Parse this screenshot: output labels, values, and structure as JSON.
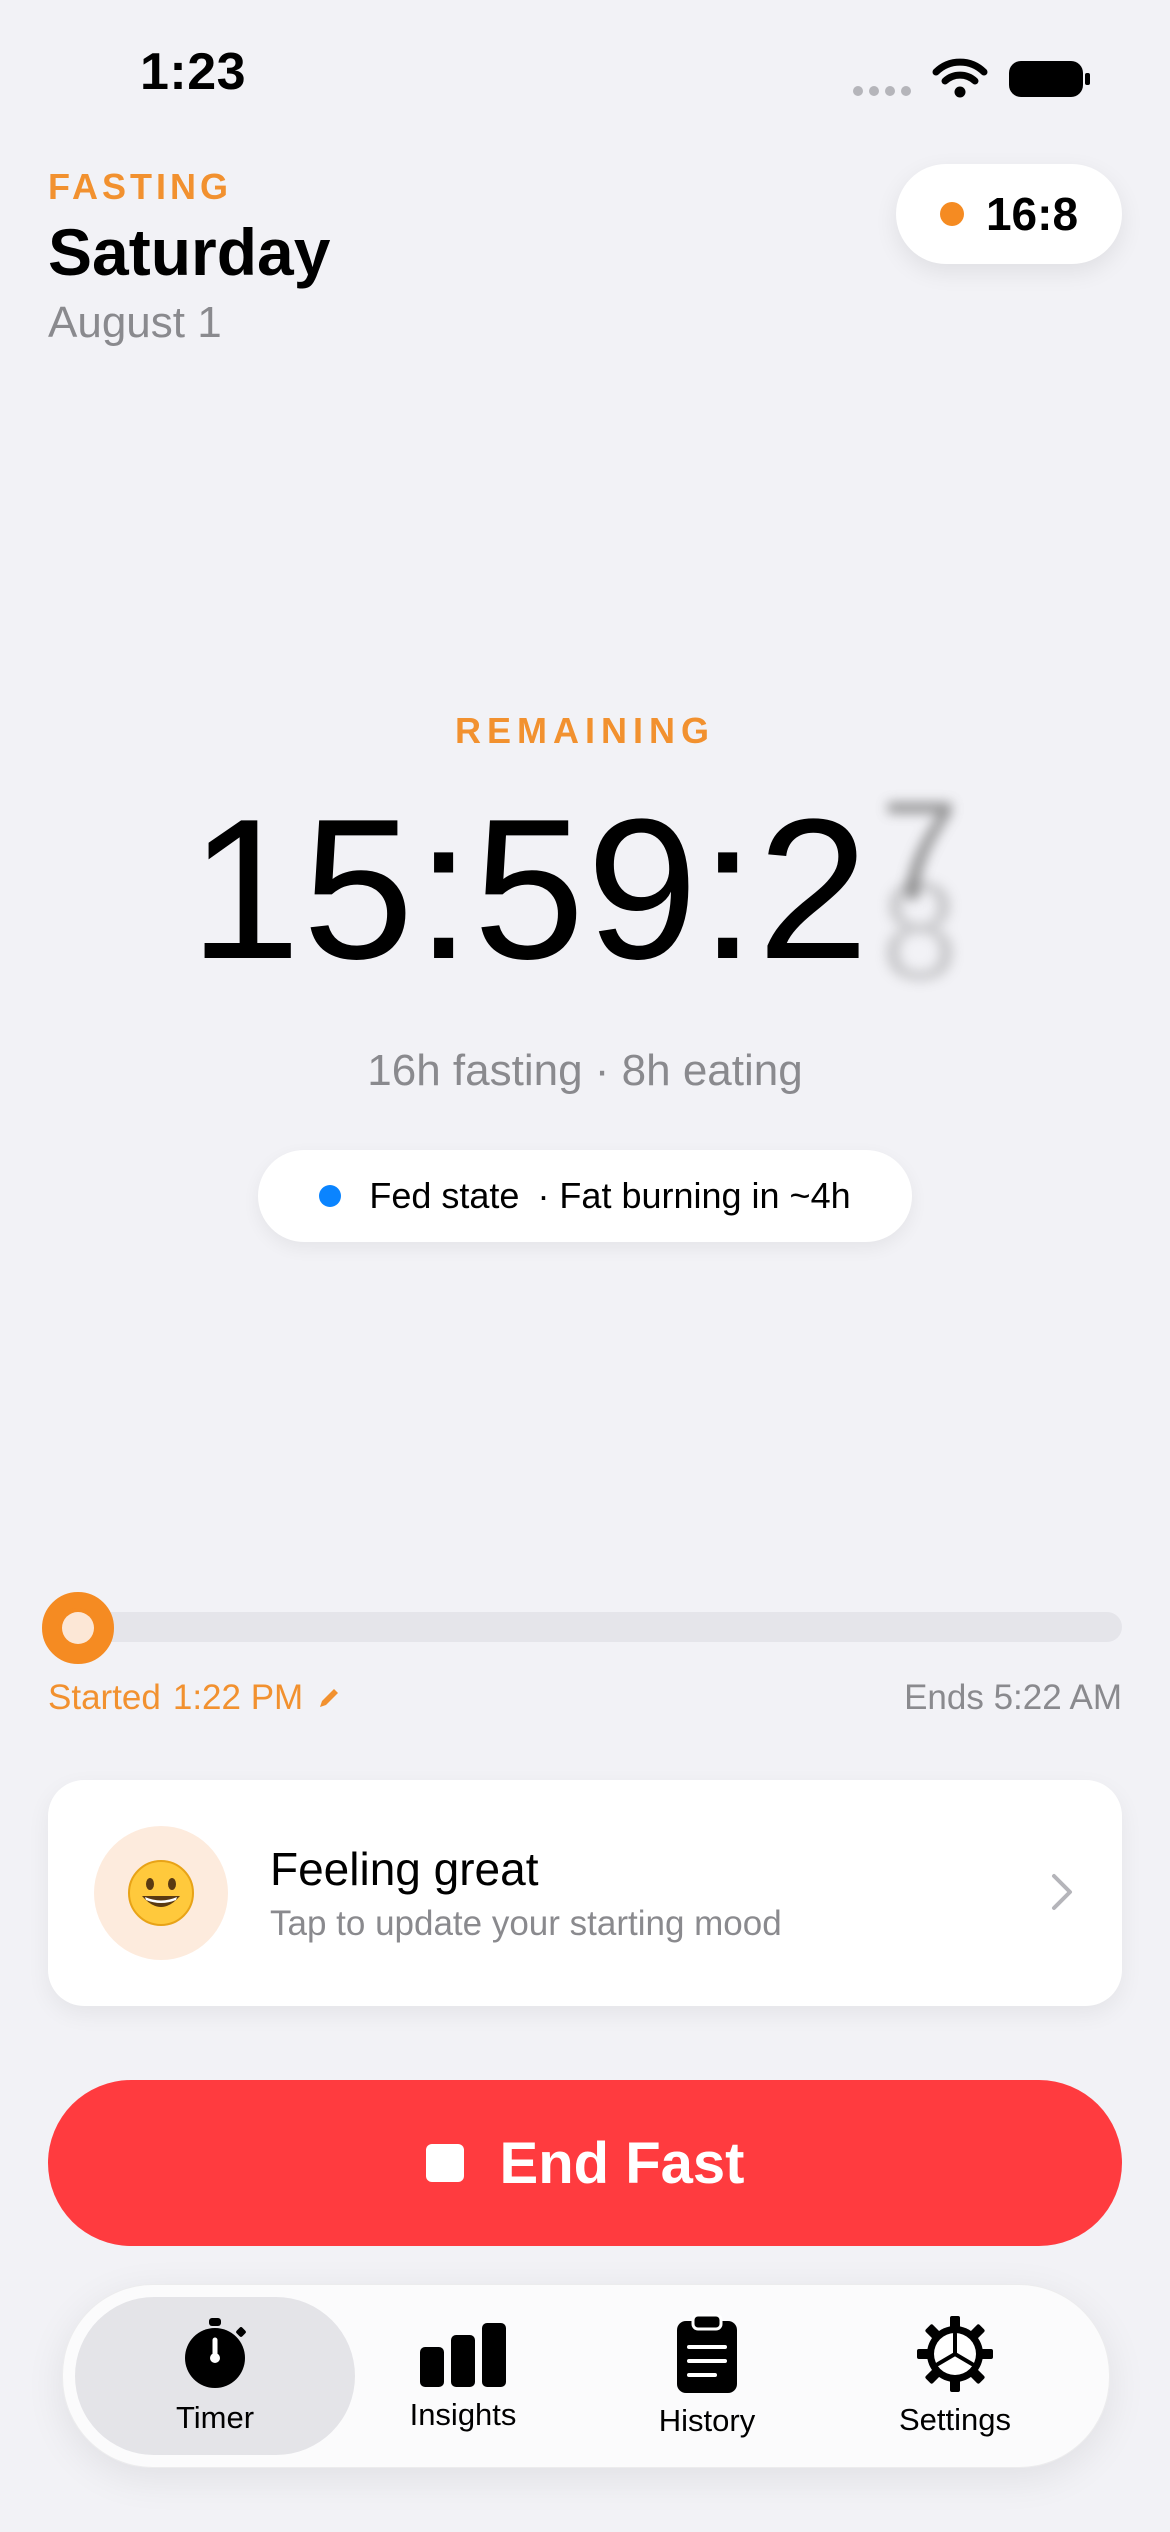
{
  "status_bar": {
    "time": "1:23"
  },
  "header": {
    "eyebrow": "FASTING",
    "day": "Saturday",
    "date": "August 1",
    "plan_label": "16:8"
  },
  "timer": {
    "heading": "REMAINING",
    "value": "15:59:2",
    "rolling_digit_top": "7",
    "rolling_digit_bottom": "8",
    "phase_summary": "16h fasting · 8h eating",
    "state_label": "Fed state",
    "state_next": "· Fat burning in ~4h"
  },
  "progress": {
    "fraction": 0.0,
    "started_label": "Started",
    "started_time": "1:22 PM",
    "ends_label": "Ends",
    "ends_time": "5:22 AM"
  },
  "mood": {
    "emoji": "😀",
    "title": "Feeling great",
    "subtitle": "Tap to update your starting mood"
  },
  "end_button": {
    "label": "End Fast"
  },
  "tabs": [
    {
      "label": "Timer",
      "icon": "stopwatch-icon",
      "active": true
    },
    {
      "label": "Insights",
      "icon": "bar-chart-icon",
      "active": false
    },
    {
      "label": "History",
      "icon": "clipboard-icon",
      "active": false
    },
    {
      "label": "Settings",
      "icon": "gear-icon",
      "active": false
    }
  ],
  "colors": {
    "accent": "#F2912F",
    "danger": "#FF3B3F",
    "state_dot": "#0A84FF"
  }
}
